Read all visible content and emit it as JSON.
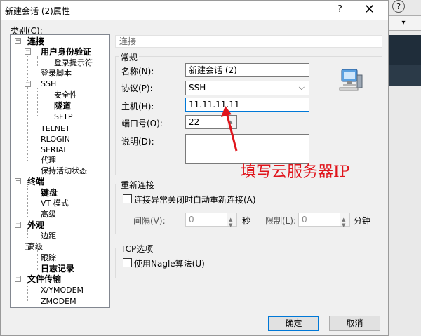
{
  "window": {
    "title": "新建会话 (2)属性",
    "help": "?",
    "close": "✕"
  },
  "background": {
    "help_glyph": "?",
    "button": "▾"
  },
  "category_label": "类别(C):",
  "tree": [
    {
      "label": "连接",
      "bold": true
    },
    {
      "label": "用户身份验证",
      "bold": true
    },
    {
      "label": "登录提示符",
      "bold": false
    },
    {
      "label": "登录脚本",
      "bold": false
    },
    {
      "label": "SSH",
      "bold": false
    },
    {
      "label": "安全性",
      "bold": false
    },
    {
      "label": "隧道",
      "bold": true
    },
    {
      "label": "SFTP",
      "bold": false
    },
    {
      "label": "TELNET",
      "bold": false
    },
    {
      "label": "RLOGIN",
      "bold": false
    },
    {
      "label": "SERIAL",
      "bold": false
    },
    {
      "label": "代理",
      "bold": false
    },
    {
      "label": "保持活动状态",
      "bold": false
    },
    {
      "label": "终端",
      "bold": true
    },
    {
      "label": "键盘",
      "bold": true
    },
    {
      "label": "VT 模式",
      "bold": false
    },
    {
      "label": "高级",
      "bold": false
    },
    {
      "label": "外观",
      "bold": true
    },
    {
      "label": "边距",
      "bold": false
    },
    {
      "label": "高级",
      "bold": false
    },
    {
      "label": "跟踪",
      "bold": false
    },
    {
      "label": "日志记录",
      "bold": true
    },
    {
      "label": "文件传输",
      "bold": true
    },
    {
      "label": "X/YMODEM",
      "bold": false
    },
    {
      "label": "ZMODEM",
      "bold": false
    }
  ],
  "panel_header": "连接",
  "general": {
    "title": "常规",
    "name_label": "名称(N):",
    "name_value": "新建会话 (2)",
    "protocol_label": "协议(P):",
    "protocol_value": "SSH",
    "host_label": "主机(H):",
    "host_value": "11.11.11.11",
    "port_label": "端口号(O):",
    "port_value": "22",
    "desc_label": "说明(D):",
    "desc_value": ""
  },
  "annotation": "填写云服务器IP",
  "reconnect": {
    "title": "重新连接",
    "checkbox_label": "连接异常关闭时自动重新连接(A)",
    "interval_label": "间隔(V):",
    "interval_value": "0",
    "interval_unit": "秒",
    "limit_label": "限制(L):",
    "limit_value": "0",
    "limit_unit": "分钟"
  },
  "tcp": {
    "title": "TCP选项",
    "checkbox_label": "使用Nagle算法(U)"
  },
  "buttons": {
    "ok": "确定",
    "cancel": "取消"
  },
  "colors": {
    "accent": "#0078d7",
    "annotation": "#e0141b"
  }
}
